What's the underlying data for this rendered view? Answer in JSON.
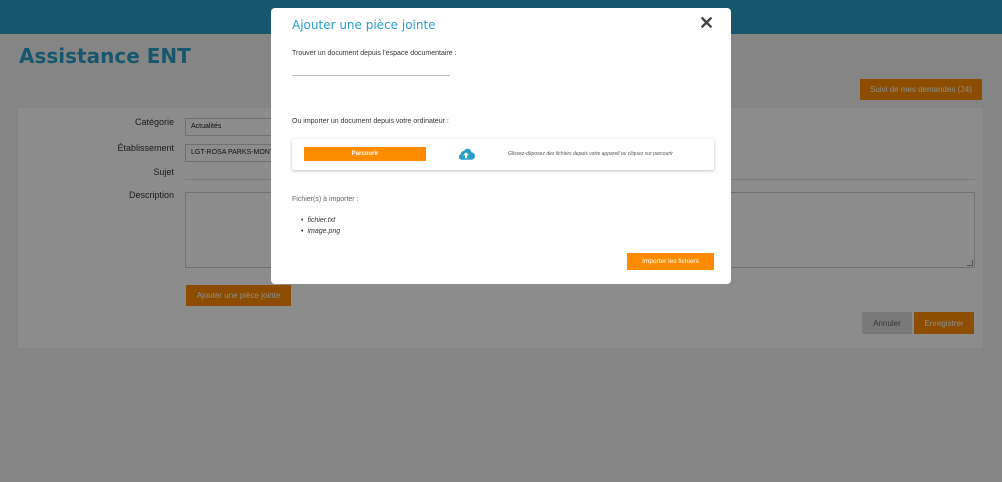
{
  "page": {
    "title": "Assistance ENT",
    "suivi_button": "Suivi de mes demandes (24)"
  },
  "form": {
    "categorie_label": "Catégorie",
    "categorie_value": "Actualités",
    "etablissement_label": "Établissement",
    "etablissement_value": "LGT-ROSA PARKS-MONTGERON",
    "sujet_label": "Sujet",
    "description_label": "Description",
    "attach_button": "Ajouter une pièce jointe",
    "cancel_button": "Annuler",
    "save_button": "Enregistrer"
  },
  "modal": {
    "title": "Ajouter une pièce jointe",
    "close_icon": "close-icon",
    "find_label": "Trouver un document depuis l'espace documentaire :",
    "find_value": "",
    "import_label": "Ou importer un document depuis votre ordinateur :",
    "browse_button": "Parcourir",
    "upload_icon": "cloud-upload-icon",
    "drop_hint": "Glissez-déposez des fichiers depuis votre appareil ou cliquez sur parcourir",
    "files_label": "Fichier(s) à importer :",
    "files": [
      "fichier.txt",
      "image.png"
    ],
    "import_button": "Importer les fichiers"
  },
  "colors": {
    "accent": "#2a9ec8",
    "button": "#ff8c00"
  }
}
